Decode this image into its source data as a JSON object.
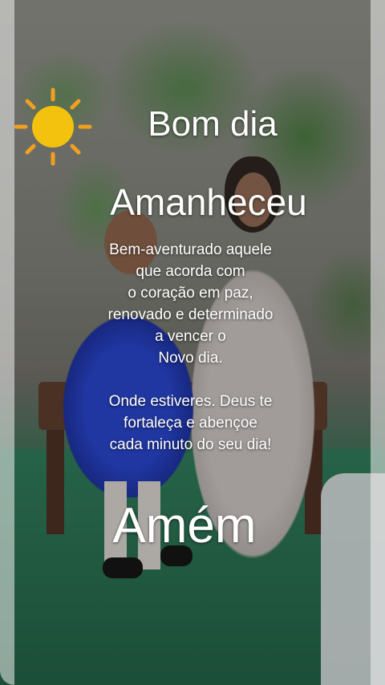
{
  "greeting": "Bom dia",
  "headline": "Amanheceu",
  "message_lines": [
    "Bem-aventurado aquele",
    "que acorda com",
    "o coração em paz,",
    "renovado e determinado",
    "a vencer o",
    "Novo dia.",
    "",
    "Onde estiveres. Deus te",
    "fortaleça e abençoe",
    "cada minuto do seu dia!"
  ],
  "closing": "Amém",
  "colors": {
    "sun": "#f2c20f",
    "sun_rays": "#f0a020",
    "text": "#ffffff",
    "dress_blue": "#2440c8",
    "floor_green": "#2c7a58"
  },
  "icons": [
    "sun-icon"
  ]
}
